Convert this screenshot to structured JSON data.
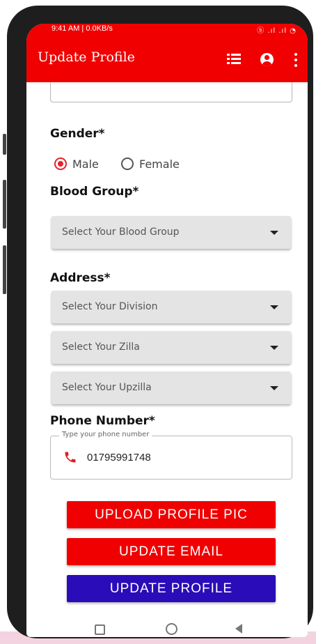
{
  "status_bar": {
    "left_text": "9:41 AM | 0.0KB/s",
    "right_text": "ⓑ .ıl .ıl ◔"
  },
  "app_bar": {
    "title": "Update Profile",
    "icons": [
      "list-icon",
      "account-circle-icon",
      "more-vert-icon"
    ]
  },
  "form": {
    "gender_label": "Gender*",
    "gender_options": [
      {
        "label": "Male",
        "selected": true
      },
      {
        "label": "Female",
        "selected": false
      }
    ],
    "blood_group_label": "Blood Group*",
    "blood_group_placeholder": "Select Your Blood Group",
    "address_label": "Address*",
    "division_placeholder": "Select Your Division",
    "zilla_placeholder": "Select Your Zilla",
    "upzilla_placeholder": "Select Your Upzilla",
    "phone_label": "Phone Number*",
    "phone_hint": "Type your phone number",
    "phone_value": "01795991748"
  },
  "buttons": {
    "upload_pic": "UPLOAD PROFILE PIC",
    "update_email": "UPDATE EMAIL",
    "update_profile": "UPDATE PROFILE"
  },
  "colors": {
    "primary_red": "#f00000",
    "radio_red": "#e8212b",
    "purple": "#2a0db8"
  }
}
